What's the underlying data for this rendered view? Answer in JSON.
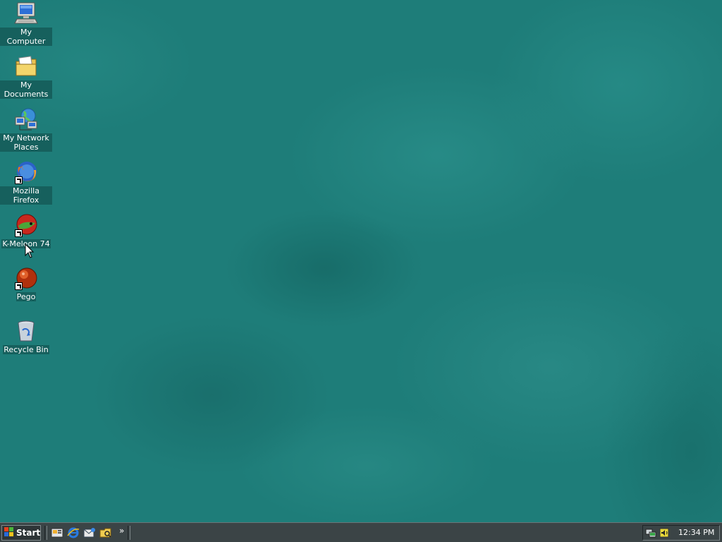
{
  "desktop": {
    "icons": [
      {
        "label": "My Computer",
        "icon": "my-computer-icon"
      },
      {
        "label": "My Documents",
        "icon": "my-documents-icon"
      },
      {
        "label": "My Network Places",
        "icon": "network-places-icon"
      },
      {
        "label": "Mozilla Firefox",
        "icon": "firefox-icon"
      },
      {
        "label": "K-Meleon 74",
        "icon": "k-meleon-icon"
      },
      {
        "label": "Pego",
        "icon": "pego-icon"
      },
      {
        "label": "Recycle Bin",
        "icon": "recycle-bin-icon"
      }
    ]
  },
  "taskbar": {
    "start_label": "Start",
    "quick_launch": [
      {
        "icon": "show-desktop-icon"
      },
      {
        "icon": "internet-explorer-icon"
      },
      {
        "icon": "outlook-express-icon"
      },
      {
        "icon": "windows-explorer-icon"
      }
    ],
    "more_label": "»",
    "tray": {
      "icons": [
        "network-tray-icon",
        "volume-tray-icon"
      ],
      "clock": "12:34 PM"
    }
  },
  "colors": {
    "desktop_teal": "#1e7d79",
    "taskbar": "#3b4446",
    "label_bg": "#16605d"
  }
}
